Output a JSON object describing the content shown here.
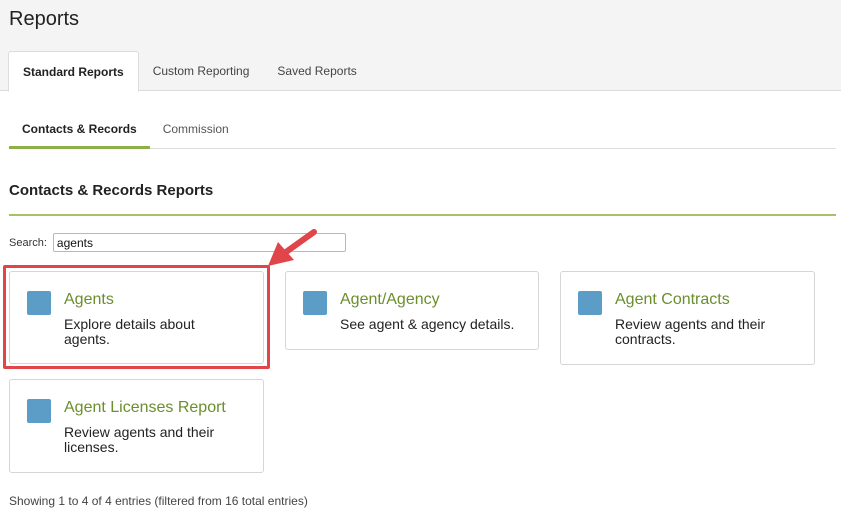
{
  "page": {
    "title": "Reports"
  },
  "top_tabs": [
    {
      "label": "Standard Reports",
      "active": true
    },
    {
      "label": "Custom Reporting",
      "active": false
    },
    {
      "label": "Saved Reports",
      "active": false
    }
  ],
  "sub_tabs": [
    {
      "label": "Contacts & Records",
      "active": true
    },
    {
      "label": "Commission",
      "active": false
    }
  ],
  "section": {
    "title": "Contacts & Records Reports"
  },
  "search": {
    "label": "Search:",
    "value": "agents"
  },
  "cards": [
    {
      "title": "Agents",
      "description": "Explore details about agents.",
      "icon": "report-icon"
    },
    {
      "title": "Agent/Agency",
      "description": "See agent & agency details.",
      "icon": "report-icon"
    },
    {
      "title": "Agent Contracts",
      "description": "Review agents and their contracts.",
      "icon": "report-icon"
    },
    {
      "title": "Agent Licenses Report",
      "description": "Review agents and their licenses.",
      "icon": "report-icon"
    }
  ],
  "footer": {
    "entries_info": "Showing 1 to 4 of 4 entries (filtered from 16 total entries)"
  },
  "colors": {
    "accent_green": "#8db04a",
    "card_title_green": "#6a8f2c",
    "icon_blue": "#5b9dc6",
    "annotation_red": "#e0454a"
  }
}
